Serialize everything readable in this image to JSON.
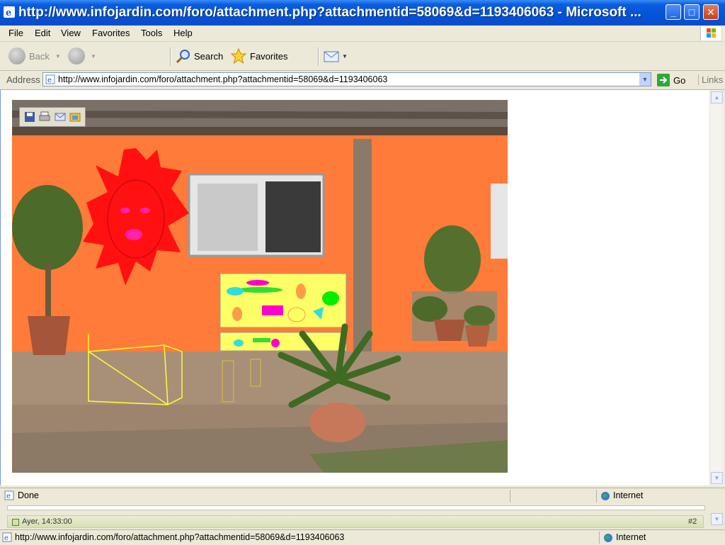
{
  "window": {
    "title": "http://www.infojardin.com/foro/attachment.php?attachmentid=58069&d=1193406063 - Microsoft ...",
    "controls": [
      "_",
      "□",
      "✕"
    ]
  },
  "menu": [
    "File",
    "Edit",
    "View",
    "Favorites",
    "Tools",
    "Help"
  ],
  "toolbar": {
    "back_label": "Back",
    "search_label": "Search",
    "favorites_label": "Favorites"
  },
  "address": {
    "label": "Address",
    "url": "http://www.infojardin.com/foro/attachment.php?attachmentid=58069&d=1193406063",
    "go_label": "Go",
    "links_label": "Links"
  },
  "status": {
    "text": "Done",
    "zone": "Internet"
  },
  "forum_strip": {
    "timestamp": "Ayer, 14:33:00",
    "post_number": "#2"
  },
  "status2": {
    "url": "http://www.infojardin.com/foro/attachment.php?attachmentid=58069&d=1193406063",
    "zone": "Internet"
  },
  "colors": {
    "title_blue": "#0453d8",
    "wall_orange": "#ff7b39",
    "sun_red": "#ff1111",
    "panel_yellow": "#ffff66"
  }
}
